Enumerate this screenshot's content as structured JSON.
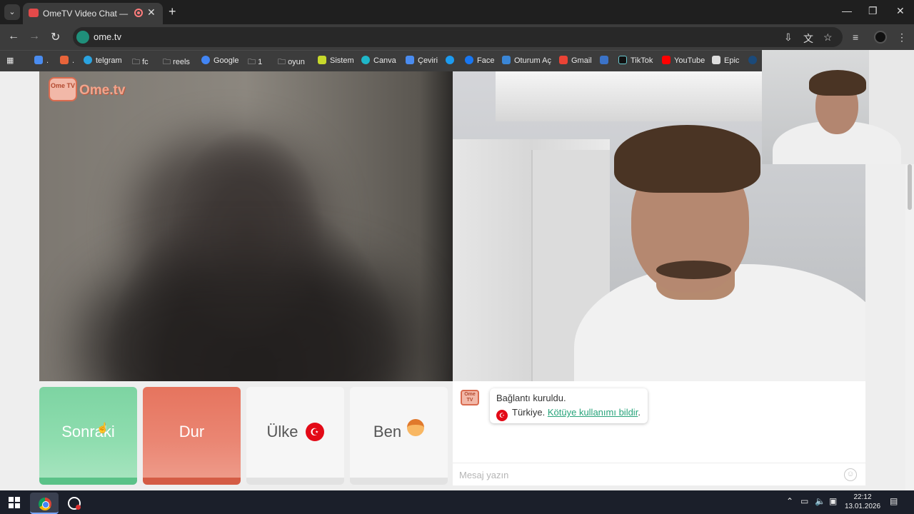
{
  "browser": {
    "tab_title": "OmeTV Video Chat — Omegle",
    "tab_close": "✕",
    "new_tab": "+",
    "url": "ome.tv",
    "icons": [
      "tab-list-icon",
      "back-icon",
      "forward-icon",
      "reload-icon",
      "install-icon",
      "translate-icon",
      "star-icon",
      "media-icon",
      "profile-icon",
      "menu-icon"
    ]
  },
  "bookmarks": [
    {
      "label": ".",
      "icon_color": "#4a8cf0"
    },
    {
      "label": ".",
      "icon_color": "#e8643a"
    },
    {
      "label": "telgram",
      "icon_color": "#2aa3e0"
    },
    {
      "label": "fc",
      "icon_color": "#777777"
    },
    {
      "label": "reels",
      "icon_color": "#777777"
    },
    {
      "label": "Google",
      "icon_color": "#4285f4"
    },
    {
      "label": "1",
      "icon_color": "#777777"
    },
    {
      "label": "oyun",
      "icon_color": "#777777"
    },
    {
      "label": "Sistem",
      "icon_color": "#c7d92b"
    },
    {
      "label": "Canva",
      "icon_color": "#1fb7c9"
    },
    {
      "label": "Çeviri",
      "icon_color": "#4a8cf0"
    },
    {
      "label": "",
      "icon_color": "#1d9bf0"
    },
    {
      "label": "Face",
      "icon_color": "#1877f2"
    },
    {
      "label": "Oturum Aç",
      "icon_color": "#3a86d6"
    },
    {
      "label": "Gmail",
      "icon_color": "#ea4335"
    },
    {
      "label": "",
      "icon_color": "#3b73c8"
    },
    {
      "label": "TikTok",
      "icon_color": "#111111"
    },
    {
      "label": "YouTube",
      "icon_color": "#ff0000"
    },
    {
      "label": "Epic",
      "icon_color": "#dddddd"
    },
    {
      "label": "",
      "icon_color": "#1b4a7a"
    }
  ],
  "site": {
    "logo_badge": "Ome TV",
    "logo_text": "Ome.tv"
  },
  "controls": {
    "next_label": "Sonraki",
    "stop_label": "Dur",
    "country_label": "Ülke",
    "me_label": "Ben"
  },
  "chat": {
    "logo_badge": "Ome TV",
    "status_line": "Bağlantı kuruldu.",
    "country_prefix": "Türkiye.",
    "report_link": "Kötüye kullanımı bildir",
    "report_suffix": ".",
    "input_placeholder": "Mesaj yazın"
  },
  "taskbar": {
    "time": "22:12",
    "date": "13.01.2026",
    "tray_icons": [
      "chevron-up-icon",
      "battery-icon",
      "volume-icon",
      "network-icon",
      "notification-icon"
    ]
  },
  "colors": {
    "next": "#7dd4a2",
    "stop": "#e6745e",
    "link": "#27a37a",
    "flag": "#e30a17"
  }
}
